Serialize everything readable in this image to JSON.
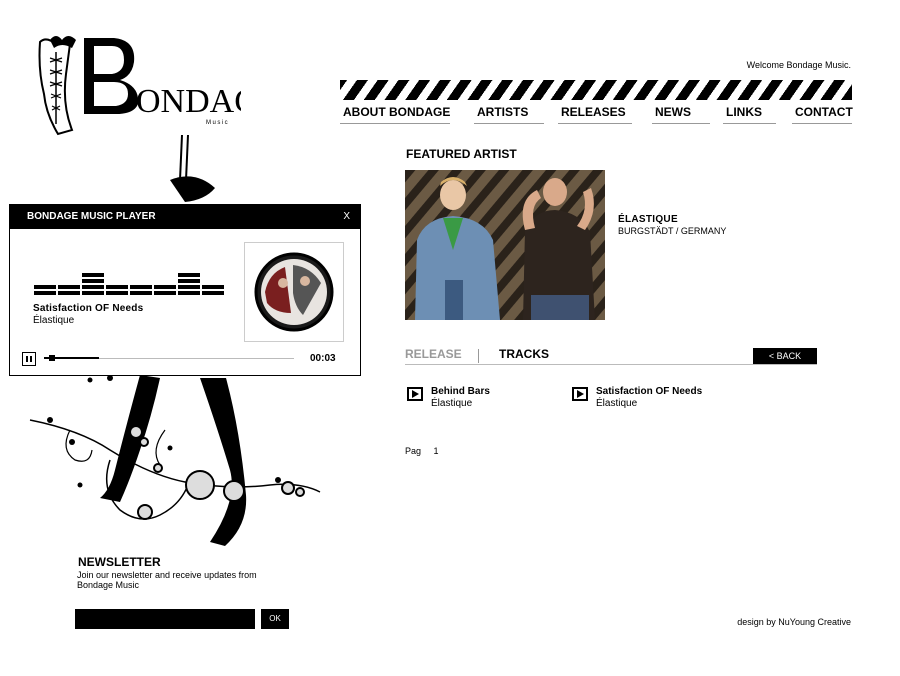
{
  "brand": {
    "logo_text": "BONDAGE",
    "logo_sub": "Music"
  },
  "header": {
    "welcome": "Welcome Bondage Music."
  },
  "nav": {
    "items": [
      "ABOUT BONDAGE",
      "ARTISTS",
      "RELEASES",
      "NEWS",
      "LINKS",
      "CONTACT"
    ]
  },
  "featured": {
    "title": "FEATURED ARTIST",
    "artist_name": "ÉLASTIQUE",
    "location": "BURGSTÄDT / GERMANY"
  },
  "tabs": {
    "release": "RELEASE",
    "tracks": "TRACKS",
    "back": "< BACK"
  },
  "tracks": [
    {
      "title": "Behind Bars",
      "artist": "Élastique"
    },
    {
      "title": "Satisfaction OF Needs",
      "artist": "Élastique"
    }
  ],
  "pagination": {
    "label": "Pag",
    "pages": [
      "1"
    ]
  },
  "player": {
    "title": "BONDAGE MUSIC PLAYER",
    "close": "X",
    "now_playing_title": "Satisfaction OF Needs",
    "now_playing_artist": "Élastique",
    "time": "00:03",
    "progress": 0.22
  },
  "newsletter": {
    "title": "NEWSLETTER",
    "text": "Join our newsletter and receive updates from Bondage Music",
    "input_value": "",
    "ok": "OK"
  },
  "footer": {
    "credit": "design by NuYoung Creative"
  },
  "colors": {
    "ink": "#000000",
    "muted": "#999999",
    "bg": "#ffffff"
  }
}
